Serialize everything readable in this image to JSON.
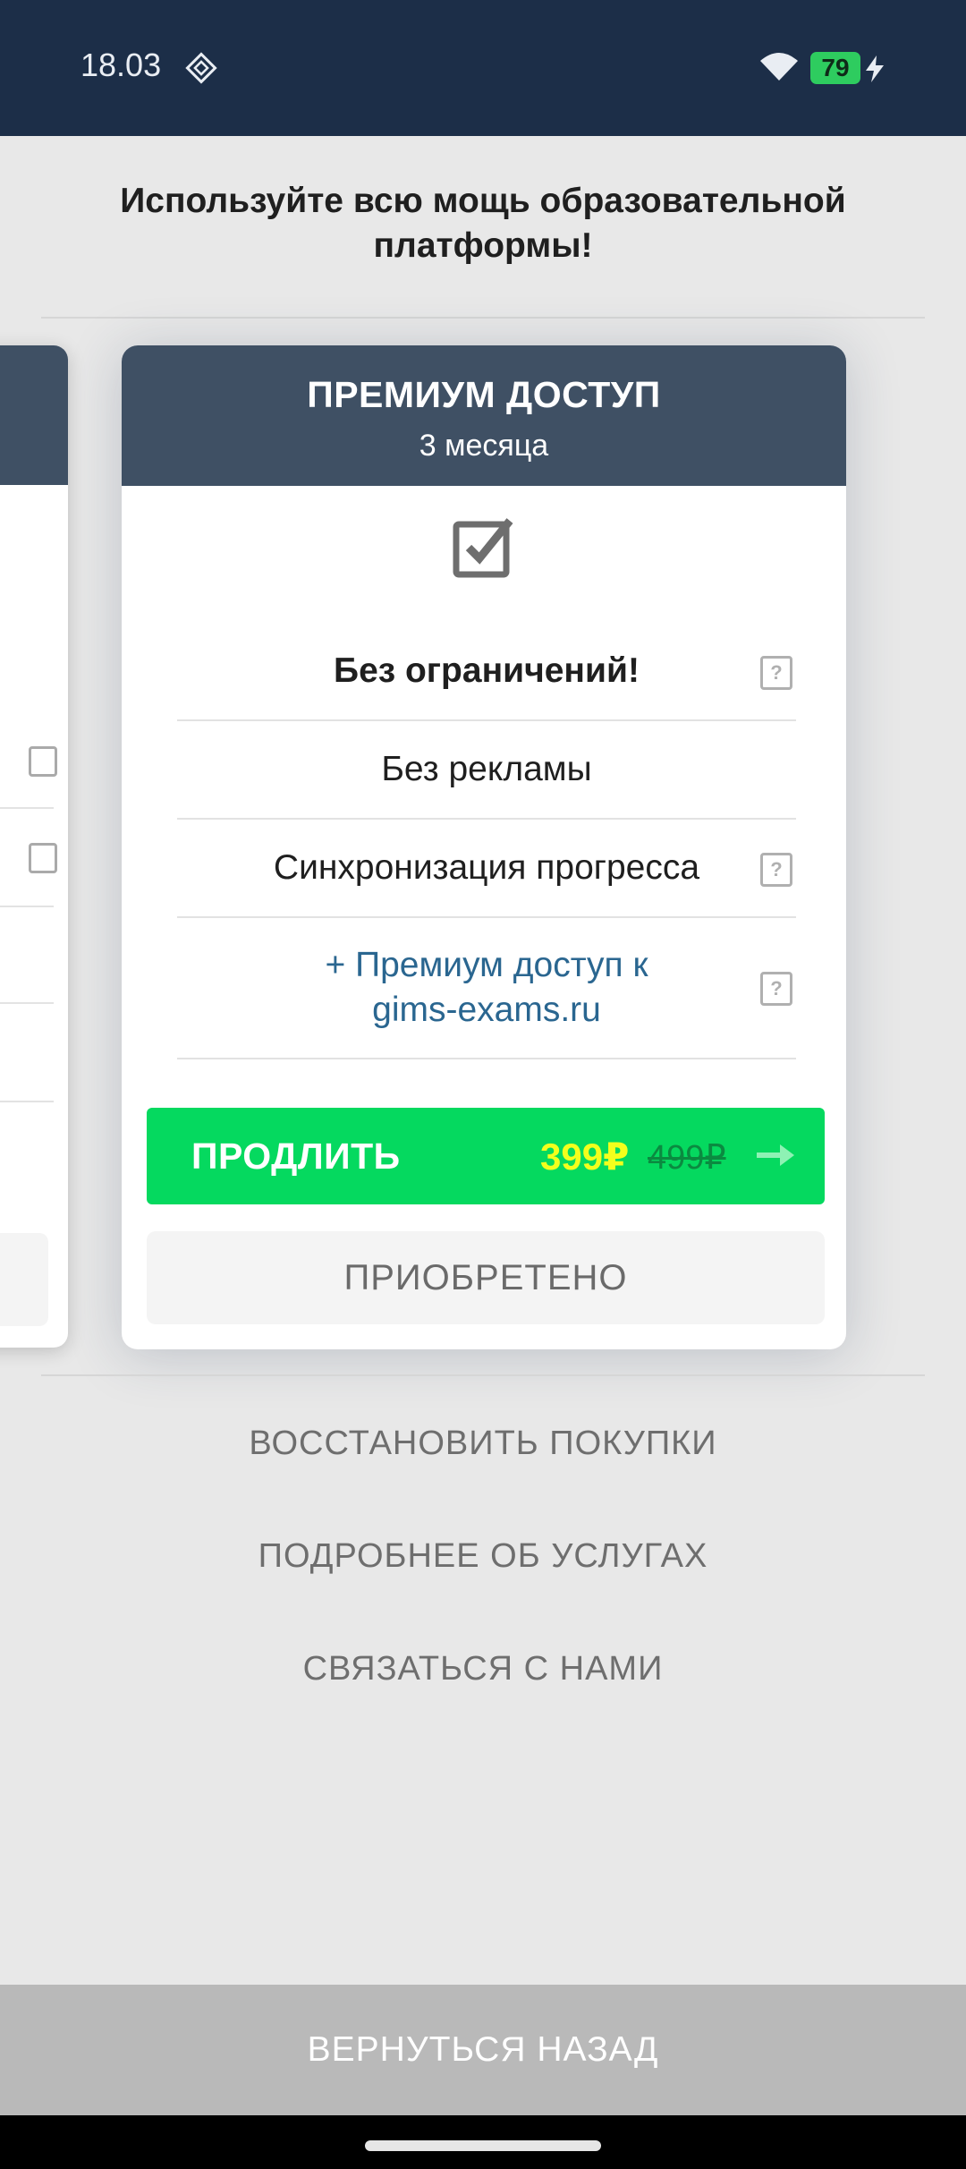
{
  "status_bar": {
    "time": "18.03",
    "battery": "79",
    "icons": [
      "diamond-icon",
      "wifi-icon",
      "battery-icon",
      "charging-bolt-icon"
    ]
  },
  "headline": "Используйте всю мощь образовательной платформы!",
  "plan": {
    "title": "ПРЕМИУМ ДОСТУП",
    "period": "3 месяца",
    "features": [
      {
        "label": "Без ограничений!",
        "has_help": true
      },
      {
        "label": "Без рекламы",
        "has_help": false
      },
      {
        "label": "Синхронизация прогресса",
        "has_help": true
      },
      {
        "label": "+ Премиум доступ к gims-exams.ru",
        "has_help": true
      }
    ],
    "help_glyph": "?",
    "buy_button": {
      "label": "ПРОДЛИТЬ",
      "price": "399₽",
      "old_price": "499₽"
    },
    "owned_button": "ПРИОБРЕТЕНО"
  },
  "links": {
    "restore": "ВОССТАНОВИТЬ ПОКУПКИ",
    "details": "ПОДРОБНЕЕ ОБ УСЛУГАХ",
    "contact": "СВЯЗАТЬСЯ С НАМИ"
  },
  "back_button": "ВЕРНУТЬСЯ НАЗАД",
  "colors": {
    "status_bar": "#1c2e48",
    "card_header": "#3f5064",
    "buy_button": "#05d95f",
    "price": "#f3ff1c",
    "link_feature": "#2a6690",
    "background": "#e8e8e8"
  }
}
